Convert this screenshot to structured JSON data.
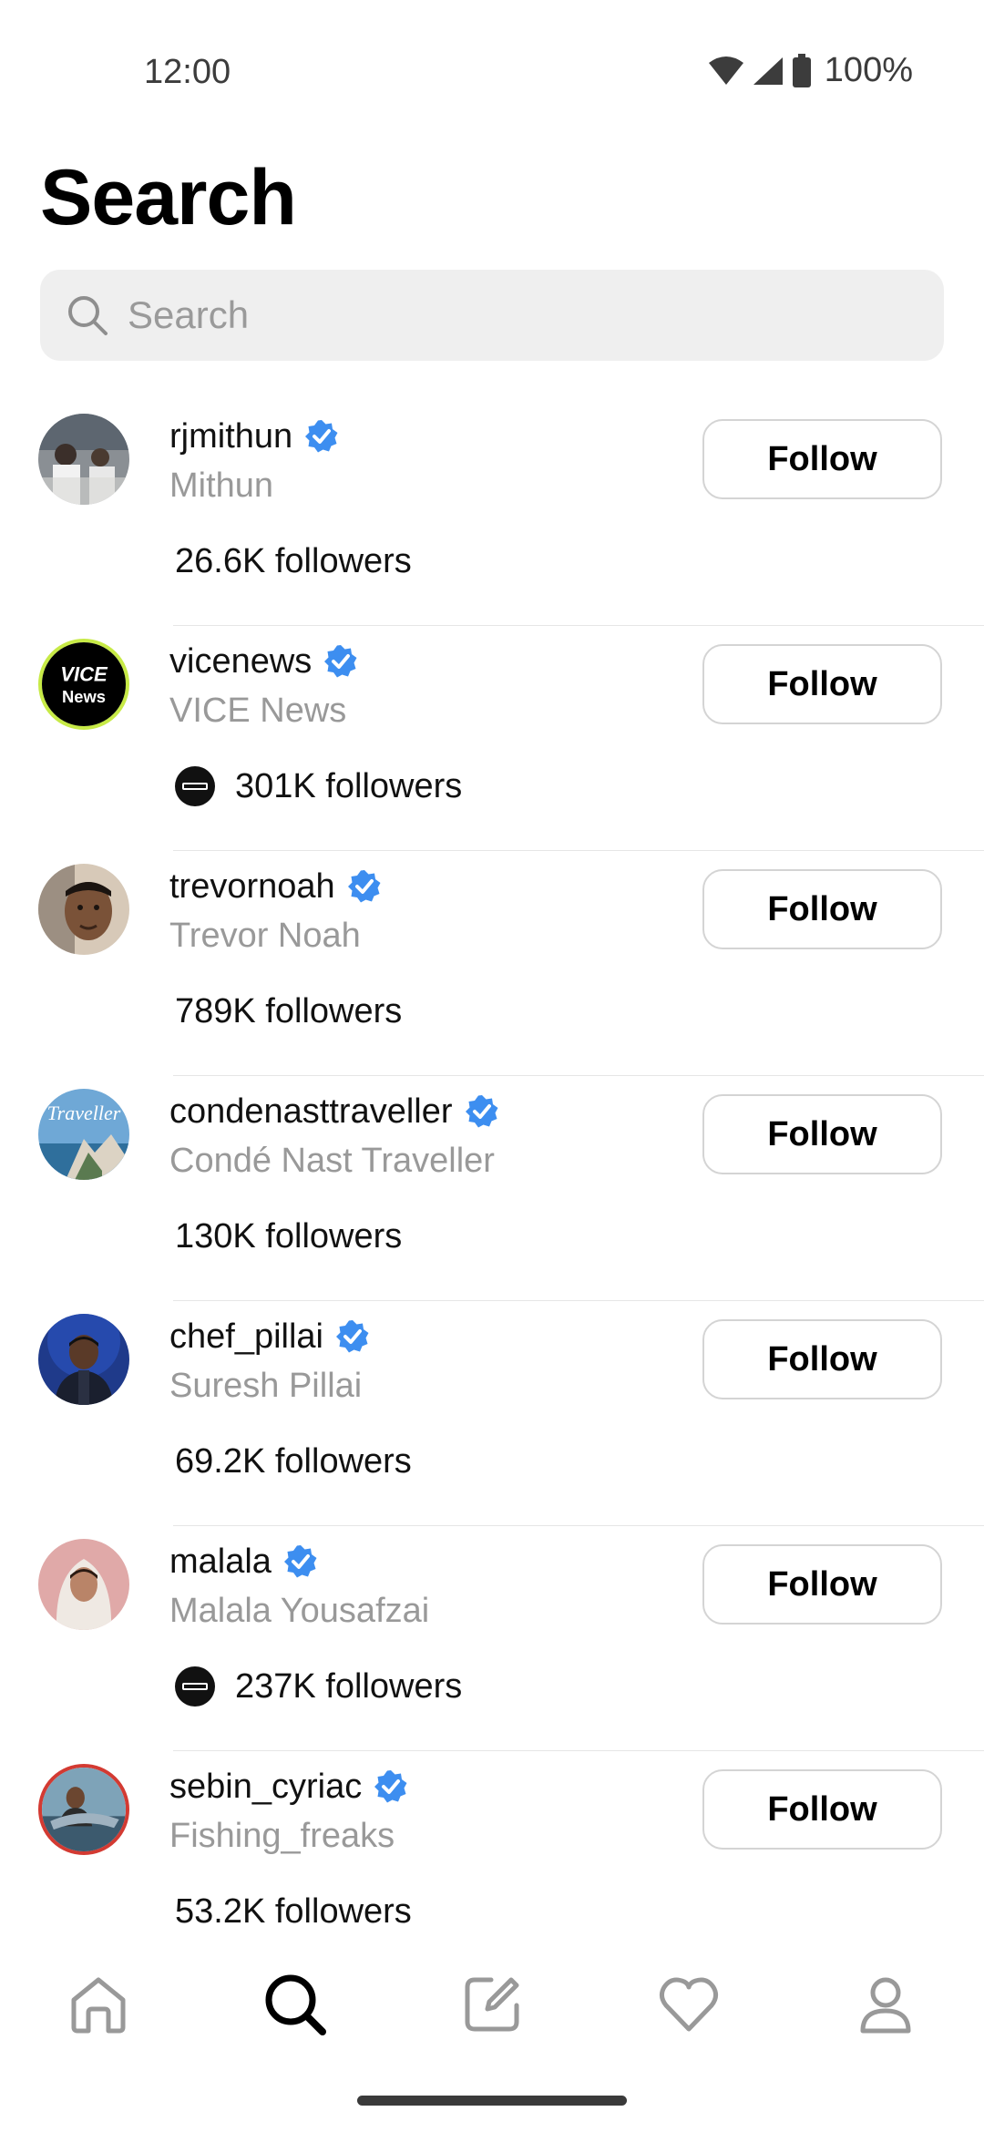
{
  "status_bar": {
    "time": "12:00",
    "battery": "100%"
  },
  "header": {
    "title": "Search"
  },
  "search": {
    "placeholder": "Search",
    "value": ""
  },
  "results": [
    {
      "username": "rjmithun",
      "fullname": "Mithun",
      "followers": "26.6K followers",
      "follow_label": "Follow",
      "verified": true
    },
    {
      "username": "vicenews",
      "fullname": "VICE News",
      "followers": "301K followers",
      "follow_label": "Follow",
      "verified": true,
      "avatar_text_1": "VICE",
      "avatar_text_2": "News"
    },
    {
      "username": "trevornoah",
      "fullname": "Trevor Noah",
      "followers": "789K followers",
      "follow_label": "Follow",
      "verified": true
    },
    {
      "username": "condenasttraveller",
      "fullname": "Condé Nast Traveller",
      "followers": "130K followers",
      "follow_label": "Follow",
      "verified": true,
      "avatar_text": "Traveller"
    },
    {
      "username": "chef_pillai",
      "fullname": "Suresh Pillai",
      "followers": "69.2K followers",
      "follow_label": "Follow",
      "verified": true
    },
    {
      "username": "malala",
      "fullname": "Malala Yousafzai",
      "followers": "237K followers",
      "follow_label": "Follow",
      "verified": true
    },
    {
      "username": "sebin_cyriac",
      "fullname": "Fishing_freaks",
      "followers": "53.2K followers",
      "follow_label": "Follow",
      "verified": true
    }
  ],
  "bottom_nav": [
    "home-icon",
    "search-icon",
    "compose-icon",
    "heart-icon",
    "profile-icon"
  ],
  "colors": {
    "verified": "#3d8ef0",
    "muted_text": "#999999",
    "button_border": "#d4d4d4"
  }
}
